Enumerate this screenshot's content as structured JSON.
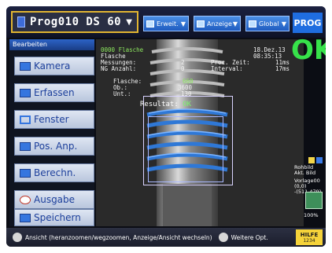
{
  "topbar": {
    "program_label": "Prog010 DS 60",
    "buttons": [
      {
        "label": "Erweit.",
        "icon": "expand-icon"
      },
      {
        "label": "Anzeige",
        "icon": "display-icon"
      },
      {
        "label": "Global",
        "icon": "global-icon"
      }
    ],
    "prog_badge": "PROG"
  },
  "left_panel": {
    "title": "Bearbeiten",
    "items": [
      {
        "label": "Kamera",
        "icon": "camera-icon"
      },
      {
        "label": "Erfassen",
        "icon": "capture-icon"
      },
      {
        "label": "Fenster",
        "icon": "window-icon"
      },
      {
        "label": "Pos. Anp.",
        "icon": "position-adjust-icon"
      },
      {
        "label": "Berechn.",
        "icon": "calculate-icon"
      },
      {
        "label": "Ausgabe",
        "icon": "output-icon"
      },
      {
        "label": "Speichern",
        "icon": "save-icon"
      }
    ]
  },
  "camera_overlay": {
    "header_left": "0000 Flasche",
    "date": "18.Dez.13",
    "time": "08:35:13",
    "lines_left": [
      "Flasche",
      "Messungen:",
      "NG Anzahl:"
    ],
    "values_left": [
      "2",
      "0"
    ],
    "proc_time_label": "Proc. Zeit:",
    "proc_time_value": "11ms",
    "interval_label": "Interval:",
    "interval_value": "17ms",
    "flasche_label": "Flasche:",
    "ob_label": "Ob.:",
    "unt_label": "Unt.:",
    "flasche_value": "660",
    "ob_value": "3600",
    "unt_value": "130",
    "result_label": "Resultat:",
    "result_value": "OK"
  },
  "right_panel": {
    "ok_text": "OK",
    "rohbild": "Rohbild",
    "akt_bild": "Akt. Bild",
    "vorlage": "Vorlage00",
    "coords_1": "(0,0)",
    "coords_2": "-(511,479)",
    "zoom": "100%"
  },
  "bottombar": {
    "view_text": "Ansicht (heranzoomen/wegzoomen, Anzeige/Ansicht wechseln)",
    "menu_text": "Weitere Opt.",
    "help_label": "HILFE",
    "help_sub": "1234"
  },
  "colors": {
    "accent_blue": "#1f6de0",
    "ok_green": "#37e24a",
    "selection_gold": "#e0b431",
    "help_yellow": "#f5d33a"
  }
}
